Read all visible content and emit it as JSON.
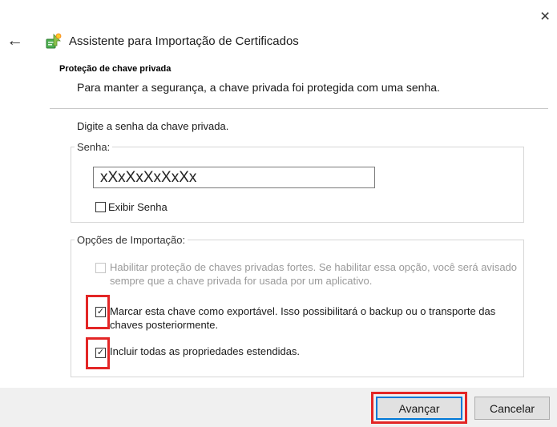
{
  "window": {
    "close_glyph": "×",
    "back_glyph": "←",
    "title": "Assistente para Importação de Certificados"
  },
  "section": {
    "title": "Proteção de chave privada",
    "description": "Para manter a segurança, a chave privada foi protegida com uma senha."
  },
  "prompt": "Digite a senha da chave privada.",
  "password_group": {
    "label": "Senha:",
    "value": "xXxXxXxXxXx",
    "show_password": {
      "label": "Exibir Senha",
      "checked": false
    }
  },
  "options_group": {
    "label": "Opções de Importação:",
    "options": [
      {
        "label": "Habilitar proteção de chaves privadas fortes. Se habilitar essa opção, você será avisado sempre que a chave privada for usada por um aplicativo.",
        "checked": false,
        "enabled": false
      },
      {
        "label": "Marcar esta chave como exportável. Isso possibilitará o backup ou o transporte das chaves posteriormente.",
        "checked": true,
        "enabled": true,
        "highlighted": true
      },
      {
        "label": "Incluir todas as propriedades estendidas.",
        "checked": true,
        "enabled": true,
        "highlighted": true
      }
    ]
  },
  "buttons": {
    "next": "Avançar",
    "cancel": "Cancelar"
  },
  "colors": {
    "highlight": "#e32626",
    "focus": "#0078d7",
    "footer_bg": "#f0f0f0"
  },
  "icons": [
    "close-icon",
    "back-arrow-icon",
    "certificate-wizard-icon",
    "checkbox-icon"
  ]
}
